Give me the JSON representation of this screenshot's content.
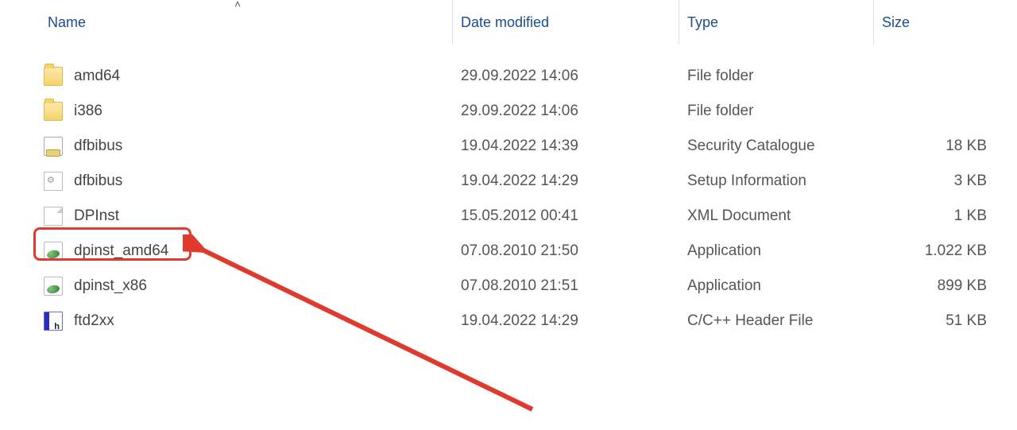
{
  "columns": {
    "name": "Name",
    "date": "Date modified",
    "type": "Type",
    "size": "Size"
  },
  "sort": {
    "column": "name",
    "direction": "asc",
    "caret": "˄"
  },
  "rows": [
    {
      "icon": "folder",
      "name": "amd64",
      "date": "29.09.2022 14:06",
      "type": "File folder",
      "size": ""
    },
    {
      "icon": "folder",
      "name": "i386",
      "date": "29.09.2022 14:06",
      "type": "File folder",
      "size": ""
    },
    {
      "icon": "cat",
      "name": "dfbibus",
      "date": "19.04.2022 14:39",
      "type": "Security Catalogue",
      "size": "18 KB"
    },
    {
      "icon": "inf",
      "name": "dfbibus",
      "date": "19.04.2022 14:29",
      "type": "Setup Information",
      "size": "3 KB"
    },
    {
      "icon": "doc",
      "name": "DPInst",
      "date": "15.05.2012 00:41",
      "type": "XML Document",
      "size": "1 KB"
    },
    {
      "icon": "exe",
      "name": "dpinst_amd64",
      "date": "07.08.2010 21:50",
      "type": "Application",
      "size": "1.022 KB"
    },
    {
      "icon": "exe",
      "name": "dpinst_x86",
      "date": "07.08.2010 21:51",
      "type": "Application",
      "size": "899 KB"
    },
    {
      "icon": "h",
      "name": "ftd2xx",
      "date": "19.04.2022 14:29",
      "type": "C/C++ Header File",
      "size": "51 KB"
    }
  ],
  "annotation": {
    "highlighted_row_index": 5,
    "arrow_color": "#e03a2f"
  }
}
